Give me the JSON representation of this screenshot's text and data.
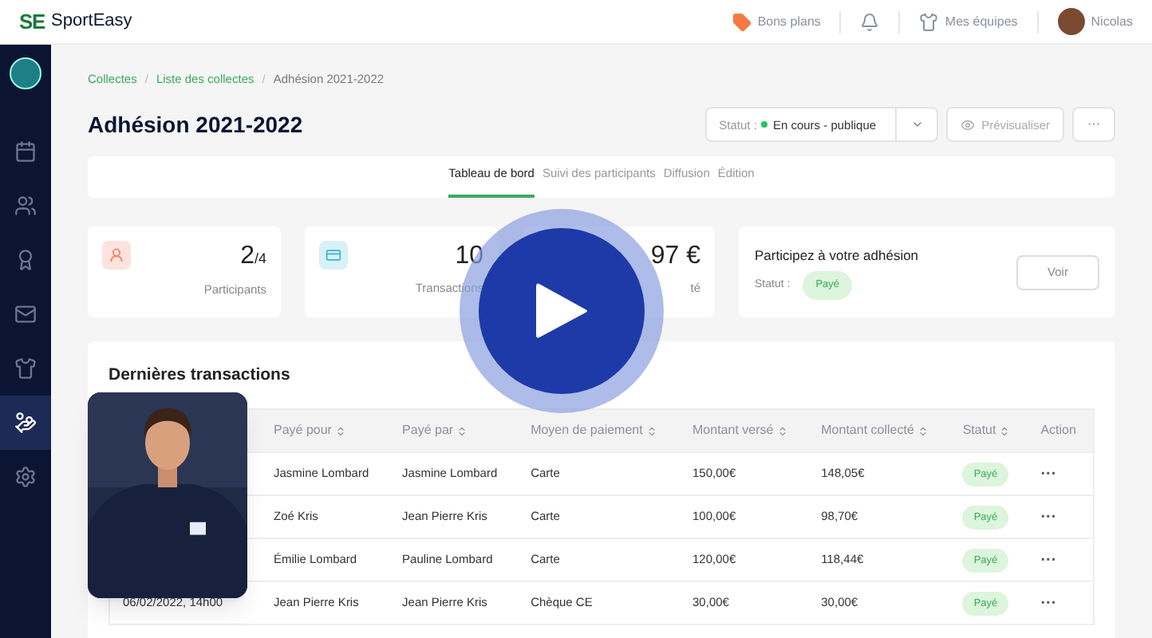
{
  "header": {
    "logo_mark": "SE",
    "logo_text": "SportEasy",
    "deals": "Bons plans",
    "teams": "Mes équipes",
    "user": "Nicolas"
  },
  "sidebar": {
    "items": [
      {
        "selected": false
      },
      {
        "selected": false
      },
      {
        "selected": false
      },
      {
        "selected": false
      },
      {
        "selected": false
      },
      {
        "selected": true
      },
      {
        "selected": false
      }
    ]
  },
  "breadcrumb": [
    "Collectes",
    "Liste des collectes",
    "Adhésion 2021-2022"
  ],
  "breadcrumb_separator": "/",
  "title": "Adhésion 2021-2022",
  "status": {
    "label": "Statut :",
    "value": "En cours - publique",
    "color": "#22c55e"
  },
  "preview_button": "Prévisualiser",
  "more_button": "···",
  "tabs": [
    {
      "label": "Tableau de bord",
      "selected": true
    },
    {
      "label": "Suivi des participants",
      "selected": false
    },
    {
      "label": "Diffusion",
      "selected": false
    },
    {
      "label": "Édition",
      "selected": false
    }
  ],
  "stats": [
    {
      "value": "2",
      "sub": "/4",
      "label": "Participants",
      "kind": "participants"
    },
    {
      "value": "10",
      "label": "Transactions",
      "kind": "transactions"
    },
    {
      "value": "97 €",
      "label": "té",
      "kind": "amount"
    }
  ],
  "join": {
    "title": "Participez à votre adhésion",
    "status_label": "Statut :",
    "status": "Payé",
    "button": "Voir"
  },
  "transactions": {
    "title": "Dernières transactions",
    "columns": [
      "Payé pour",
      "Payé par",
      "Moyen de paiement",
      "Montant versé",
      "Montant collecté",
      "Statut",
      "Action"
    ],
    "rows": [
      {
        "for": "Jasmine Lombard",
        "by": "Jasmine Lombard",
        "method": "Carte",
        "paid": "150,00€",
        "collected": "148,05€",
        "status": "Payé",
        "action": "···"
      },
      {
        "for": "Zoé Kris",
        "by": "Jean Pierre Kris",
        "method": "Carte",
        "paid": "100,00€",
        "collected": "98,70€",
        "status": "Payé",
        "action": "···"
      },
      {
        "for": "Émilie Lombard",
        "by": "Pauline Lombard",
        "method": "Carte",
        "paid": "120,00€",
        "collected": "118,44€",
        "status": "Payé",
        "action": "···"
      },
      {
        "date": "06/02/2022, 14h00",
        "for": "Jean Pierre Kris",
        "by": "Jean Pierre Kris",
        "method": "Chèque CE",
        "paid": "30,00€",
        "collected": "30,00€",
        "status": "Payé",
        "action": "···"
      }
    ]
  }
}
